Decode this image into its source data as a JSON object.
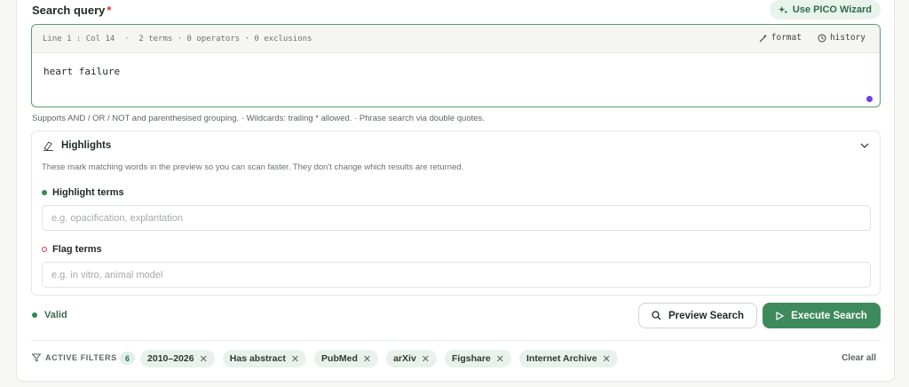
{
  "query": {
    "label": "Search query",
    "required_mark": "*",
    "pico_button": "Use PICO Wizard",
    "status_line": "Line 1 : Col 14  ·  2 terms · 0 operators · 0 exclusions",
    "format_label": "format",
    "history_label": "history",
    "value": "heart failure",
    "help": "Supports AND / OR / NOT and parenthesised grouping. · Wildcards: trailing * allowed. · Phrase search via double quotes."
  },
  "highlights": {
    "title": "Highlights",
    "description": "These mark matching words in the preview so you can scan faster. They don't change which results are returned.",
    "highlight_label": "Highlight terms",
    "highlight_placeholder": "e.g. opacification, explantation",
    "flag_label": "Flag terms",
    "flag_placeholder": "e.g. in vitro, animal model"
  },
  "status": {
    "label": "Valid"
  },
  "actions": {
    "preview": "Preview Search",
    "execute": "Execute Search"
  },
  "filters": {
    "label": "ACTIVE FILTERS",
    "count": "6",
    "chips": [
      "2010–2026",
      "Has abstract",
      "PubMed",
      "arXiv",
      "Figshare",
      "Internet Archive"
    ],
    "clear": "Clear all"
  },
  "colors": {
    "accent": "#3e8a5c",
    "accent_light": "#e8f2eb",
    "required": "#d23c3c",
    "cursor_dot": "#6a3ff0"
  },
  "icons": {
    "pico": "sparkle-icon",
    "format": "wand-icon",
    "history": "history-icon",
    "highlights": "highlighter-icon",
    "collapse": "chevron-down-icon",
    "preview": "search-icon",
    "execute": "play-icon",
    "filters": "filter-icon",
    "remove": "close-icon"
  }
}
